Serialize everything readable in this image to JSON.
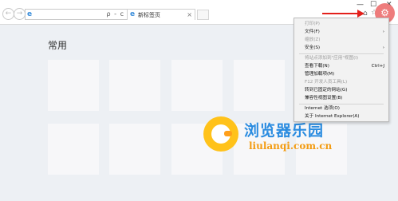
{
  "browser": {
    "nav": {
      "back_glyph": "←",
      "forward_glyph": "→"
    },
    "address_bar": {
      "value": "",
      "tools_text": "ρ - c"
    },
    "tab": {
      "label": "新标签页",
      "close_glyph": "×"
    },
    "window_controls": {
      "minimize": "—",
      "maximize": "☐",
      "close": "✕"
    }
  },
  "page": {
    "heading": "常用",
    "tiles_count_visible": 12
  },
  "tools_menu": {
    "items": [
      {
        "label": "打印(P)",
        "disabled": true,
        "submenu": false,
        "shortcut": ""
      },
      {
        "label": "文件(F)",
        "disabled": false,
        "submenu": true,
        "shortcut": ""
      },
      {
        "label": "缩放(Z)",
        "disabled": true,
        "submenu": false,
        "shortcut": ""
      },
      {
        "label": "安全(S)",
        "disabled": false,
        "submenu": true,
        "shortcut": ""
      },
      {
        "label": "将站点添加到\"应用\"视图(I)",
        "disabled": true,
        "submenu": false,
        "shortcut": ""
      },
      {
        "label": "查看下载(N)",
        "disabled": false,
        "submenu": false,
        "shortcut": "Ctrl+J"
      },
      {
        "label": "管理加载项(M)",
        "disabled": false,
        "submenu": false,
        "shortcut": ""
      },
      {
        "label": "F12 开发人员工具(L)",
        "disabled": true,
        "submenu": false,
        "shortcut": ""
      },
      {
        "label": "转到已固定的网站(G)",
        "disabled": false,
        "submenu": false,
        "shortcut": ""
      },
      {
        "label": "兼容性视图设置(B)",
        "disabled": false,
        "submenu": false,
        "shortcut": ""
      },
      {
        "label": "Internet 选项(O)",
        "disabled": false,
        "submenu": false,
        "shortcut": ""
      },
      {
        "label": "关于 Internet Explorer(A)",
        "disabled": false,
        "submenu": false,
        "shortcut": ""
      }
    ]
  },
  "watermark": {
    "title": "浏览器乐园",
    "url": "liulanqi.com.cn"
  },
  "colors": {
    "accent_arrow": "#e3201b",
    "gear_highlight": "#ee7676",
    "watermark_blue": "#2b8ce0",
    "watermark_orange": "#f39c12",
    "watermark_logo": "#ffc21a"
  },
  "icons": [
    "back-icon",
    "forward-icon",
    "ie-logo-icon",
    "search-icon",
    "refresh-icon",
    "close-icon",
    "home-icon",
    "star-icon",
    "gear-icon",
    "arrow-icon",
    "chevron-right-icon"
  ]
}
